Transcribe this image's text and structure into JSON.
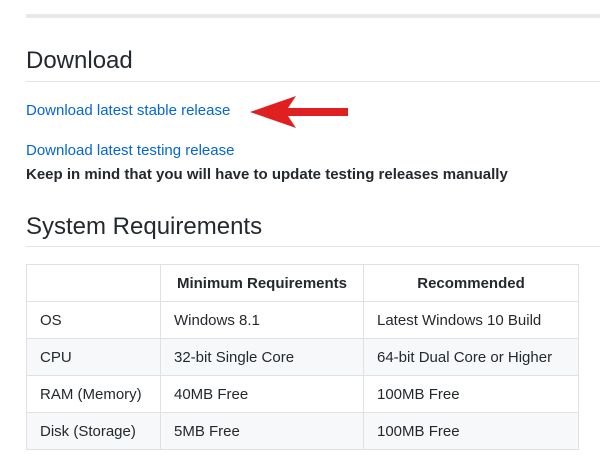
{
  "download": {
    "heading": "Download",
    "stable_link": "Download latest stable release",
    "testing_link": "Download latest testing release",
    "note": "Keep in mind that you will have to update testing releases manually",
    "arrow_color": "#e02020"
  },
  "requirements": {
    "heading": "System Requirements",
    "columns": [
      "",
      "Minimum Requirements",
      "Recommended"
    ],
    "rows": [
      [
        "OS",
        "Windows 8.1",
        "Latest Windows 10 Build"
      ],
      [
        "CPU",
        "32-bit Single Core",
        "64-bit Dual Core or Higher"
      ],
      [
        "RAM (Memory)",
        "40MB Free",
        "100MB Free"
      ],
      [
        "Disk (Storage)",
        "5MB Free",
        "100MB Free"
      ]
    ]
  },
  "colors": {
    "link": "#0366d6",
    "text": "#24292e",
    "border": "#dfe2e5",
    "alt_row": "#f6f8fa"
  }
}
